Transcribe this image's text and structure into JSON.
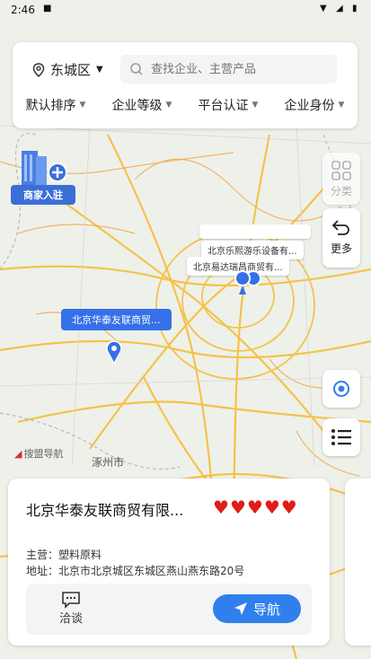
{
  "status_bar": {
    "time": "2:46",
    "icons": [
      "sim-icon",
      "wifi-icon",
      "signal-icon",
      "battery-icon"
    ]
  },
  "search_bar": {
    "district": "东城区",
    "placeholder": "查找企业、主营产品"
  },
  "filters": [
    {
      "label": "默认排序"
    },
    {
      "label": "企业等级"
    },
    {
      "label": "平台认证"
    },
    {
      "label": "企业身份"
    }
  ],
  "merchant_badge": {
    "label": "商家入驻"
  },
  "side_tools": {
    "category_label": "分类",
    "more_label": "更多"
  },
  "map": {
    "labels": [
      {
        "text": "北京乐熙游乐设备有..."
      },
      {
        "text": "北京易达瑞昌商贸有..."
      },
      {
        "text": "北京华泰友联商贸..."
      }
    ],
    "place_name": "涿州市",
    "provider": "搜盟导航"
  },
  "company_card": {
    "name": "北京华泰友联商贸有限...",
    "rating": 5,
    "main_business_label": "主营：",
    "main_business": "塑料原料",
    "address_label": "地址：",
    "address": "北京市北京城区东城区燕山燕东路20号",
    "chat_label": "洽谈",
    "navigate_label": "导航"
  },
  "colors": {
    "accent": "#2f80ed",
    "heart": "#e21b1b",
    "marker": "#3570e8"
  }
}
